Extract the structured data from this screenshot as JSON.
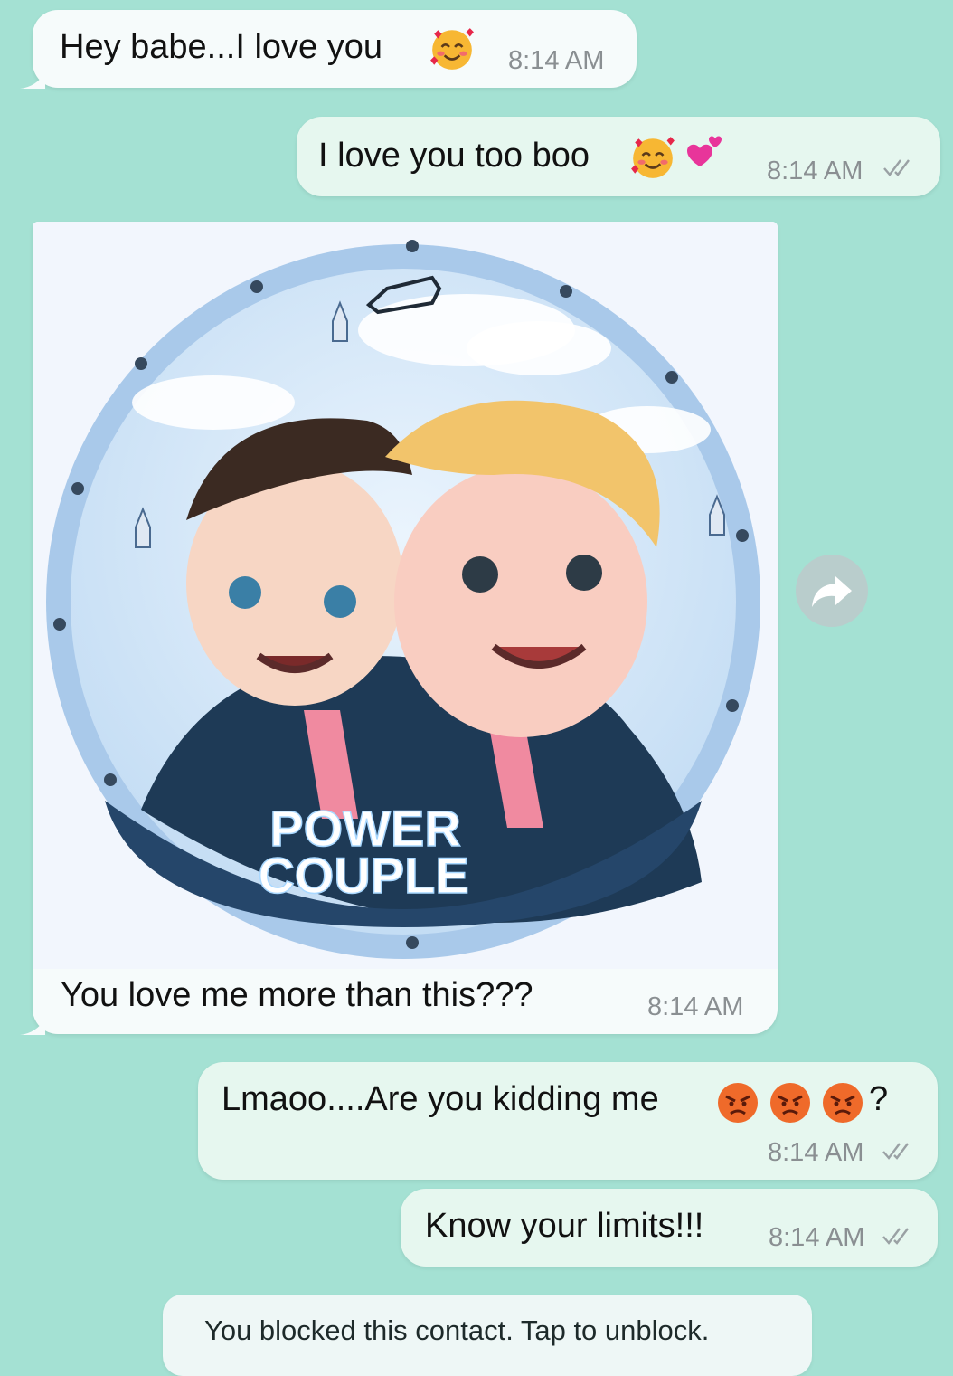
{
  "messages": [
    {
      "text": "Hey babe...I love you",
      "time": "8:14 AM"
    },
    {
      "text": "I love you too boo",
      "time": "8:14 AM"
    },
    {
      "image": {
        "title_line1": "POWER",
        "title_line2": "COUPLE"
      },
      "text": "You love me more than this???",
      "time": "8:14 AM"
    },
    {
      "text": "Lmaoo....Are you kidding me",
      "suffix": "?",
      "time": "8:14 AM"
    },
    {
      "text": "Know your limits!!!",
      "time": "8:14 AM"
    }
  ],
  "system_notice": "You blocked this contact. Tap to unblock.",
  "icons": {
    "tick": "double-check-icon",
    "forward": "forward-icon",
    "emoji_smile_hearts": "smiling-face-with-hearts-icon",
    "emoji_heart": "two-hearts-icon",
    "emoji_angry": "angry-face-icon"
  },
  "colors": {
    "background": "#a4e1d3",
    "incoming_bubble": "#f6fbfb",
    "outgoing_bubble": "#e6f7ef",
    "timestamp": "#8a8f92"
  }
}
